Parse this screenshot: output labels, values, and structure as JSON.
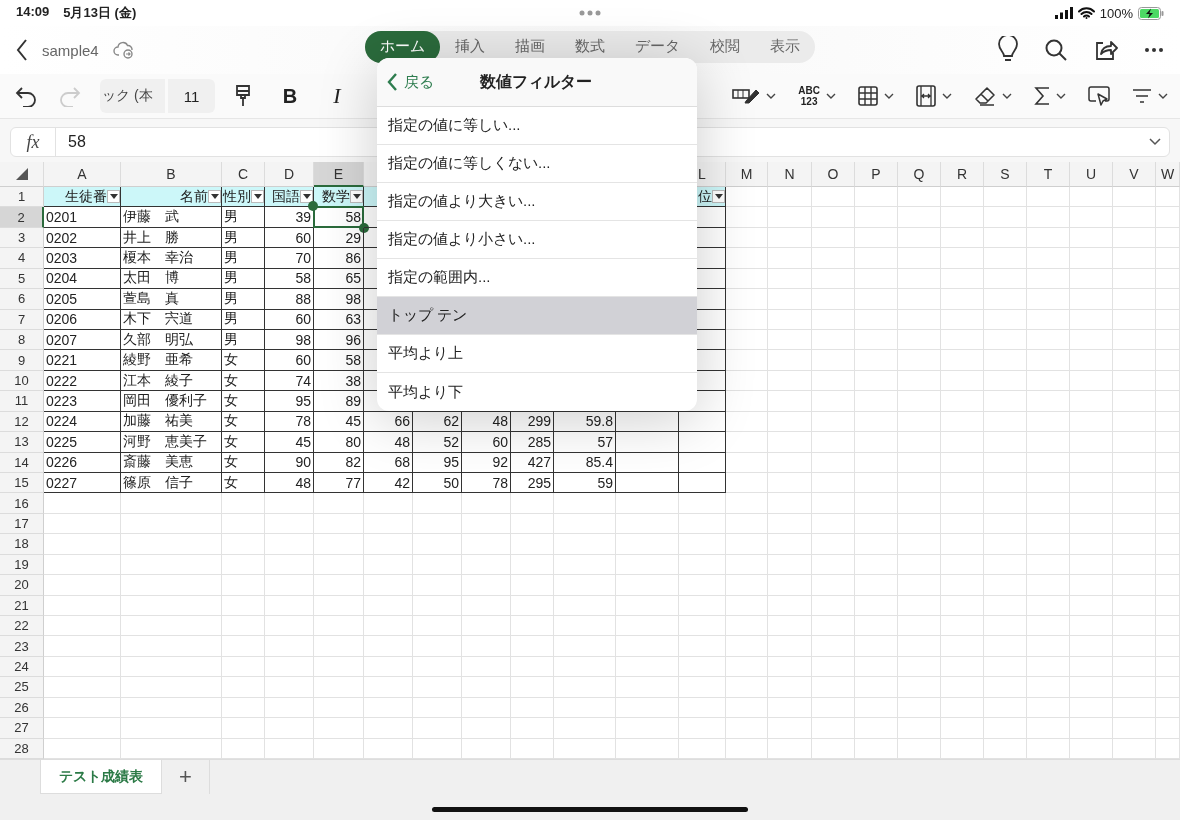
{
  "status_bar": {
    "time": "14:09",
    "date": "5月13日 (金)",
    "battery": "100%"
  },
  "file_name": "sample4",
  "tabs": [
    {
      "label": "ホーム",
      "selected": true
    },
    {
      "label": "挿入",
      "selected": false
    },
    {
      "label": "描画",
      "selected": false
    },
    {
      "label": "数式",
      "selected": false
    },
    {
      "label": "データ",
      "selected": false
    },
    {
      "label": "校閲",
      "selected": false
    },
    {
      "label": "表示",
      "selected": false
    }
  ],
  "ribbon": {
    "redo": {
      "disabled": true
    },
    "font": "ック (本",
    "size": "11",
    "bold": "B",
    "italic": "I",
    "number_format": [
      "ABC",
      "123"
    ]
  },
  "formula_bar": {
    "label": "fx",
    "value": "58"
  },
  "sheet": {
    "columns": [
      {
        "letter": "A",
        "selected": false
      },
      {
        "letter": "B",
        "selected": false
      },
      {
        "letter": "C",
        "selected": false
      },
      {
        "letter": "D",
        "selected": false
      },
      {
        "letter": "E",
        "selected": true
      },
      {
        "selected": false
      },
      {
        "selected": false
      },
      {
        "selected": false
      },
      {
        "selected": false
      },
      {
        "selected": false
      },
      {
        "selected": false
      },
      {
        "letter": "L",
        "selected": false
      },
      {
        "letter": "M",
        "selected": false
      },
      {
        "letter": "N",
        "selected": false
      },
      {
        "letter": "O",
        "selected": false
      },
      {
        "letter": "P",
        "selected": false
      },
      {
        "letter": "Q",
        "selected": false
      },
      {
        "letter": "R",
        "selected": false
      },
      {
        "letter": "S",
        "selected": false
      },
      {
        "letter": "T",
        "selected": false
      },
      {
        "letter": "U",
        "selected": false
      },
      {
        "letter": "V",
        "selected": false
      },
      {
        "letter": "W",
        "selected": false
      }
    ],
    "rows": [
      {
        "number": "1",
        "selected": false,
        "cells": [
          {
            "kind": "filter-header",
            "text": "生徒番"
          },
          {
            "kind": "filter-header",
            "text": "名前"
          },
          {
            "kind": "filter-header",
            "text": "性別"
          },
          {
            "kind": "filter-header",
            "text": "国語"
          },
          {
            "kind": "filter-header",
            "text": "数学"
          },
          {
            "kind": "header-blank"
          },
          {
            "kind": "covered"
          },
          {
            "kind": "covered"
          },
          {
            "kind": "covered"
          },
          {
            "kind": "covered"
          },
          {
            "kind": "covered"
          },
          {
            "kind": "filter-header",
            "text": "位"
          }
        ]
      },
      {
        "number": "2",
        "selected": true,
        "cells": [
          {
            "kind": "text",
            "text": "0201"
          },
          {
            "kind": "text",
            "text": "伊藤　武"
          },
          {
            "kind": "text",
            "text": "男"
          },
          {
            "kind": "number",
            "text": "39"
          },
          {
            "kind": "number",
            "text": "58"
          },
          {
            "kind": "empty"
          },
          {
            "kind": "covered"
          },
          {
            "kind": "covered"
          },
          {
            "kind": "covered"
          },
          {
            "kind": "covered"
          },
          {
            "kind": "covered"
          },
          {
            "kind": "empty"
          }
        ]
      },
      {
        "number": "3",
        "selected": false,
        "cells": [
          {
            "kind": "text",
            "text": "0202"
          },
          {
            "kind": "text",
            "text": "井上　勝"
          },
          {
            "kind": "text",
            "text": "男"
          },
          {
            "kind": "number",
            "text": "60"
          },
          {
            "kind": "number",
            "text": "29"
          },
          {
            "kind": "empty"
          },
          {
            "kind": "covered"
          },
          {
            "kind": "covered"
          },
          {
            "kind": "covered"
          },
          {
            "kind": "covered"
          },
          {
            "kind": "covered"
          },
          {
            "kind": "empty"
          }
        ]
      },
      {
        "number": "4",
        "selected": false,
        "cells": [
          {
            "kind": "text",
            "text": "0203"
          },
          {
            "kind": "text",
            "text": "榎本　幸治"
          },
          {
            "kind": "text",
            "text": "男"
          },
          {
            "kind": "number",
            "text": "70"
          },
          {
            "kind": "number",
            "text": "86"
          },
          {
            "kind": "empty"
          },
          {
            "kind": "covered"
          },
          {
            "kind": "covered"
          },
          {
            "kind": "covered"
          },
          {
            "kind": "covered"
          },
          {
            "kind": "covered"
          },
          {
            "kind": "empty"
          }
        ]
      },
      {
        "number": "5",
        "selected": false,
        "cells": [
          {
            "kind": "text",
            "text": "0204"
          },
          {
            "kind": "text",
            "text": "太田　博"
          },
          {
            "kind": "text",
            "text": "男"
          },
          {
            "kind": "number",
            "text": "58"
          },
          {
            "kind": "number",
            "text": "65"
          },
          {
            "kind": "empty"
          },
          {
            "kind": "covered"
          },
          {
            "kind": "covered"
          },
          {
            "kind": "covered"
          },
          {
            "kind": "covered"
          },
          {
            "kind": "covered"
          },
          {
            "kind": "empty"
          }
        ]
      },
      {
        "number": "6",
        "selected": false,
        "cells": [
          {
            "kind": "text",
            "text": "0205"
          },
          {
            "kind": "text",
            "text": "萱島　真"
          },
          {
            "kind": "text",
            "text": "男"
          },
          {
            "kind": "number",
            "text": "88"
          },
          {
            "kind": "number",
            "text": "98"
          },
          {
            "kind": "empty"
          },
          {
            "kind": "covered"
          },
          {
            "kind": "covered"
          },
          {
            "kind": "covered"
          },
          {
            "kind": "covered"
          },
          {
            "kind": "covered"
          },
          {
            "kind": "empty"
          }
        ]
      },
      {
        "number": "7",
        "selected": false,
        "cells": [
          {
            "kind": "text",
            "text": "0206"
          },
          {
            "kind": "text",
            "text": "木下　宍道"
          },
          {
            "kind": "text",
            "text": "男"
          },
          {
            "kind": "number",
            "text": "60"
          },
          {
            "kind": "number",
            "text": "63"
          },
          {
            "kind": "empty"
          },
          {
            "kind": "covered"
          },
          {
            "kind": "covered"
          },
          {
            "kind": "covered"
          },
          {
            "kind": "covered"
          },
          {
            "kind": "covered"
          },
          {
            "kind": "empty"
          }
        ]
      },
      {
        "number": "8",
        "selected": false,
        "cells": [
          {
            "kind": "text",
            "text": "0207"
          },
          {
            "kind": "text",
            "text": "久部　明弘"
          },
          {
            "kind": "text",
            "text": "男"
          },
          {
            "kind": "number",
            "text": "98"
          },
          {
            "kind": "number",
            "text": "96"
          },
          {
            "kind": "empty"
          },
          {
            "kind": "covered"
          },
          {
            "kind": "covered"
          },
          {
            "kind": "covered"
          },
          {
            "kind": "covered"
          },
          {
            "kind": "covered"
          },
          {
            "kind": "empty"
          }
        ]
      },
      {
        "number": "9",
        "selected": false,
        "cells": [
          {
            "kind": "text",
            "text": "0221"
          },
          {
            "kind": "text",
            "text": "綾野　亜希"
          },
          {
            "kind": "text",
            "text": "女"
          },
          {
            "kind": "number",
            "text": "60"
          },
          {
            "kind": "number",
            "text": "58"
          },
          {
            "kind": "empty"
          },
          {
            "kind": "covered"
          },
          {
            "kind": "covered"
          },
          {
            "kind": "covered"
          },
          {
            "kind": "covered"
          },
          {
            "kind": "covered"
          },
          {
            "kind": "empty"
          }
        ]
      },
      {
        "number": "10",
        "selected": false,
        "cells": [
          {
            "kind": "text",
            "text": "0222"
          },
          {
            "kind": "text",
            "text": "江本　綾子"
          },
          {
            "kind": "text",
            "text": "女"
          },
          {
            "kind": "number",
            "text": "74"
          },
          {
            "kind": "number",
            "text": "38"
          },
          {
            "kind": "empty"
          },
          {
            "kind": "covered"
          },
          {
            "kind": "covered"
          },
          {
            "kind": "covered"
          },
          {
            "kind": "covered"
          },
          {
            "kind": "covered"
          },
          {
            "kind": "empty"
          }
        ]
      },
      {
        "number": "11",
        "selected": false,
        "cells": [
          {
            "kind": "text",
            "text": "0223"
          },
          {
            "kind": "text",
            "text": "岡田　優利子"
          },
          {
            "kind": "text",
            "text": "女"
          },
          {
            "kind": "number",
            "text": "95"
          },
          {
            "kind": "number",
            "text": "89"
          },
          {
            "kind": "empty"
          },
          {
            "kind": "empty"
          },
          {
            "kind": "empty"
          },
          {
            "kind": "empty"
          },
          {
            "kind": "empty"
          },
          {
            "kind": "empty"
          },
          {
            "kind": "empty"
          }
        ]
      },
      {
        "number": "12",
        "selected": false,
        "cells": [
          {
            "kind": "text",
            "text": "0224"
          },
          {
            "kind": "text",
            "text": "加藤　祐美"
          },
          {
            "kind": "text",
            "text": "女"
          },
          {
            "kind": "number",
            "text": "78"
          },
          {
            "kind": "number",
            "text": "45"
          },
          {
            "kind": "number",
            "text": "66"
          },
          {
            "kind": "number",
            "text": "62"
          },
          {
            "kind": "number",
            "text": "48"
          },
          {
            "kind": "number",
            "text": "299"
          },
          {
            "kind": "number",
            "text": "59.8"
          },
          {
            "kind": "empty"
          },
          {
            "kind": "empty"
          }
        ]
      },
      {
        "number": "13",
        "selected": false,
        "cells": [
          {
            "kind": "text",
            "text": "0225"
          },
          {
            "kind": "text",
            "text": "河野　恵美子"
          },
          {
            "kind": "text",
            "text": "女"
          },
          {
            "kind": "number",
            "text": "45"
          },
          {
            "kind": "number",
            "text": "80"
          },
          {
            "kind": "number",
            "text": "48"
          },
          {
            "kind": "number",
            "text": "52"
          },
          {
            "kind": "number",
            "text": "60"
          },
          {
            "kind": "number",
            "text": "285"
          },
          {
            "kind": "number",
            "text": "57"
          },
          {
            "kind": "empty"
          },
          {
            "kind": "empty"
          }
        ]
      },
      {
        "number": "14",
        "selected": false,
        "cells": [
          {
            "kind": "text",
            "text": "0226"
          },
          {
            "kind": "text",
            "text": "斎藤　美恵"
          },
          {
            "kind": "text",
            "text": "女"
          },
          {
            "kind": "number",
            "text": "90"
          },
          {
            "kind": "number",
            "text": "82"
          },
          {
            "kind": "number",
            "text": "68"
          },
          {
            "kind": "number",
            "text": "95"
          },
          {
            "kind": "number",
            "text": "92"
          },
          {
            "kind": "number",
            "text": "427"
          },
          {
            "kind": "number",
            "text": "85.4"
          },
          {
            "kind": "empty"
          },
          {
            "kind": "empty"
          }
        ]
      },
      {
        "number": "15",
        "selected": false,
        "cells": [
          {
            "kind": "text",
            "text": "0227"
          },
          {
            "kind": "text",
            "text": "篠原　信子"
          },
          {
            "kind": "text",
            "text": "女"
          },
          {
            "kind": "number",
            "text": "48"
          },
          {
            "kind": "number",
            "text": "77"
          },
          {
            "kind": "number",
            "text": "42"
          },
          {
            "kind": "number",
            "text": "50"
          },
          {
            "kind": "number",
            "text": "78"
          },
          {
            "kind": "number",
            "text": "295"
          },
          {
            "kind": "number",
            "text": "59"
          },
          {
            "kind": "empty"
          },
          {
            "kind": "empty"
          }
        ]
      },
      {
        "number": "16",
        "selected": false
      },
      {
        "number": "17",
        "selected": false
      },
      {
        "number": "18",
        "selected": false
      },
      {
        "number": "19",
        "selected": false
      },
      {
        "number": "20",
        "selected": false
      },
      {
        "number": "21",
        "selected": false
      },
      {
        "number": "22",
        "selected": false
      },
      {
        "number": "23",
        "selected": false
      },
      {
        "number": "24",
        "selected": false
      },
      {
        "number": "25",
        "selected": false
      },
      {
        "number": "26",
        "selected": false
      },
      {
        "number": "27",
        "selected": false
      },
      {
        "number": "28",
        "selected": false
      }
    ]
  },
  "filter_menu": {
    "back": "戻る",
    "title": "数値フィルター",
    "items": [
      {
        "label": "指定の値に等しい...",
        "selected": false
      },
      {
        "label": "指定の値に等しくない...",
        "selected": false
      },
      {
        "label": "指定の値より大きい...",
        "selected": false
      },
      {
        "label": "指定の値より小さい...",
        "selected": false
      },
      {
        "label": "指定の範囲内...",
        "selected": false
      },
      {
        "label": "トップ テン",
        "selected": true
      },
      {
        "label": "平均より上",
        "selected": false
      },
      {
        "label": "平均より下",
        "selected": false
      }
    ]
  },
  "sheet_tabs": [
    {
      "label": "テスト成績表",
      "selected": true
    }
  ],
  "add_sheet": "+"
}
